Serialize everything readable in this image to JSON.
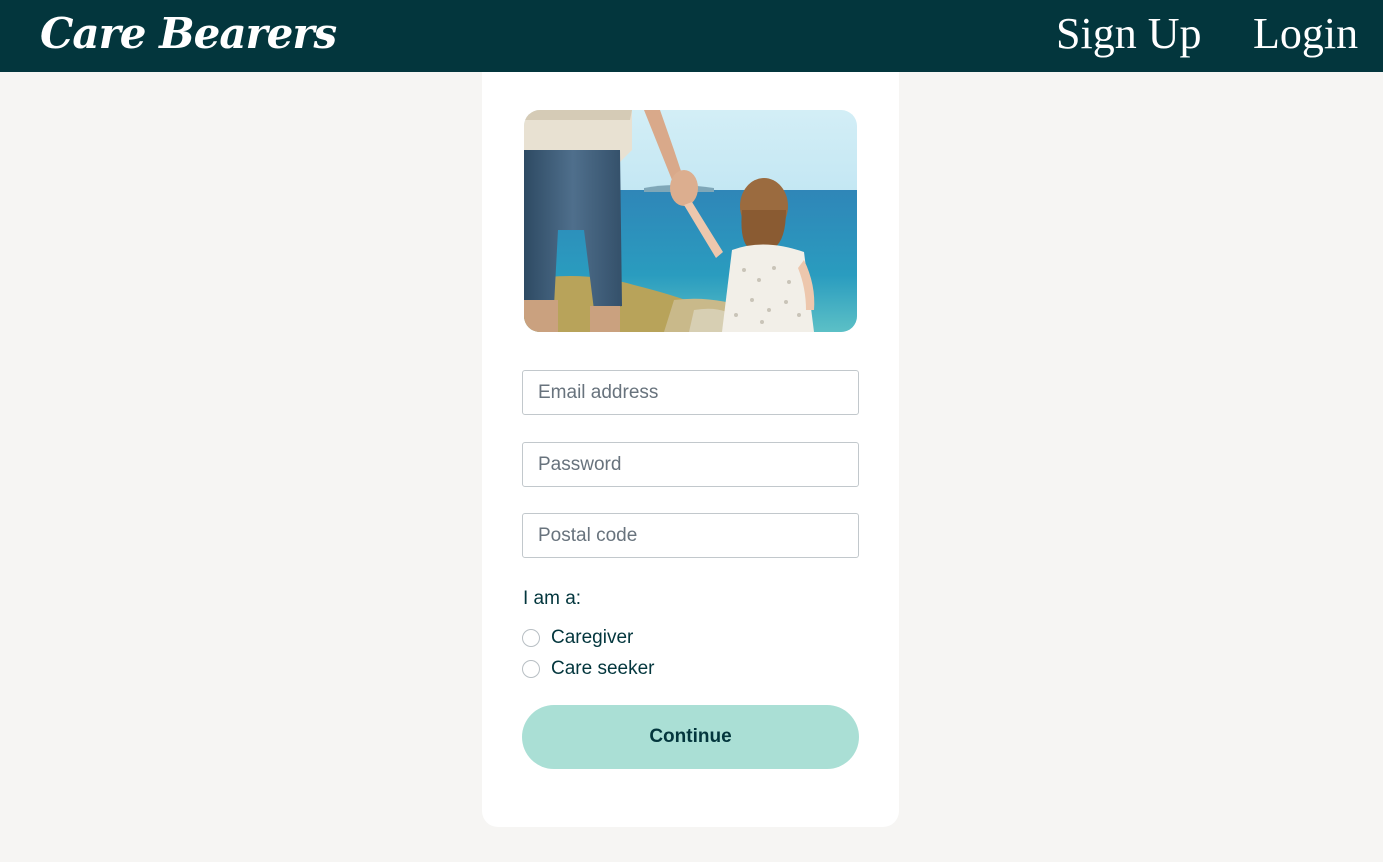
{
  "header": {
    "brand": "Care Bearers",
    "nav": {
      "signup_label": "Sign Up",
      "login_label": "Login"
    }
  },
  "form": {
    "hero_image": "parent-and-child-by-sea-photo",
    "email": {
      "placeholder": "Email address",
      "value": ""
    },
    "password": {
      "placeholder": "Password",
      "value": ""
    },
    "postal_code": {
      "placeholder": "Postal code",
      "value": ""
    },
    "role_label": "I am a:",
    "roles": [
      {
        "label": "Caregiver",
        "selected": false
      },
      {
        "label": "Care seeker",
        "selected": false
      }
    ],
    "continue_label": "Continue"
  },
  "colors": {
    "header_bg": "#03363d",
    "page_bg": "#f6f5f3",
    "button_bg": "#aadfd5",
    "text_dark": "#03363d"
  }
}
